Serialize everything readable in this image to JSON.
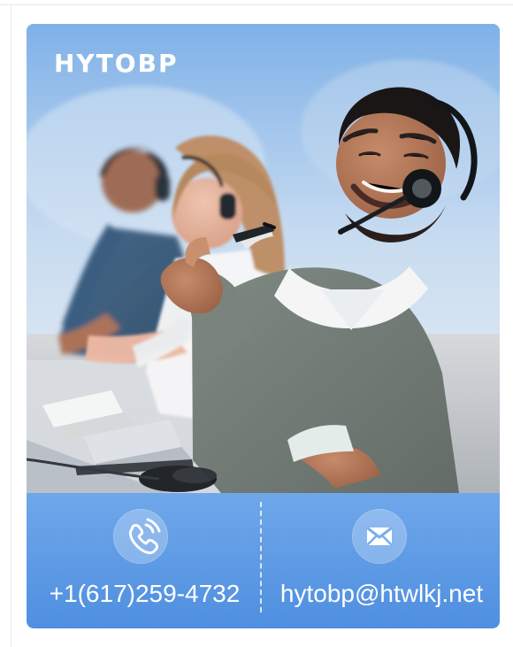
{
  "brand": {
    "logo_text": "HYTOBP"
  },
  "contact": {
    "phone_icon": "phone-icon",
    "email_icon": "mail-icon",
    "phone": "+1(617)259-4732",
    "email": "hytobp@htwlkj.net"
  },
  "colors": {
    "primary_blue": "#4f8fe0",
    "light_blue": "#86b4e6",
    "white": "#ffffff"
  }
}
